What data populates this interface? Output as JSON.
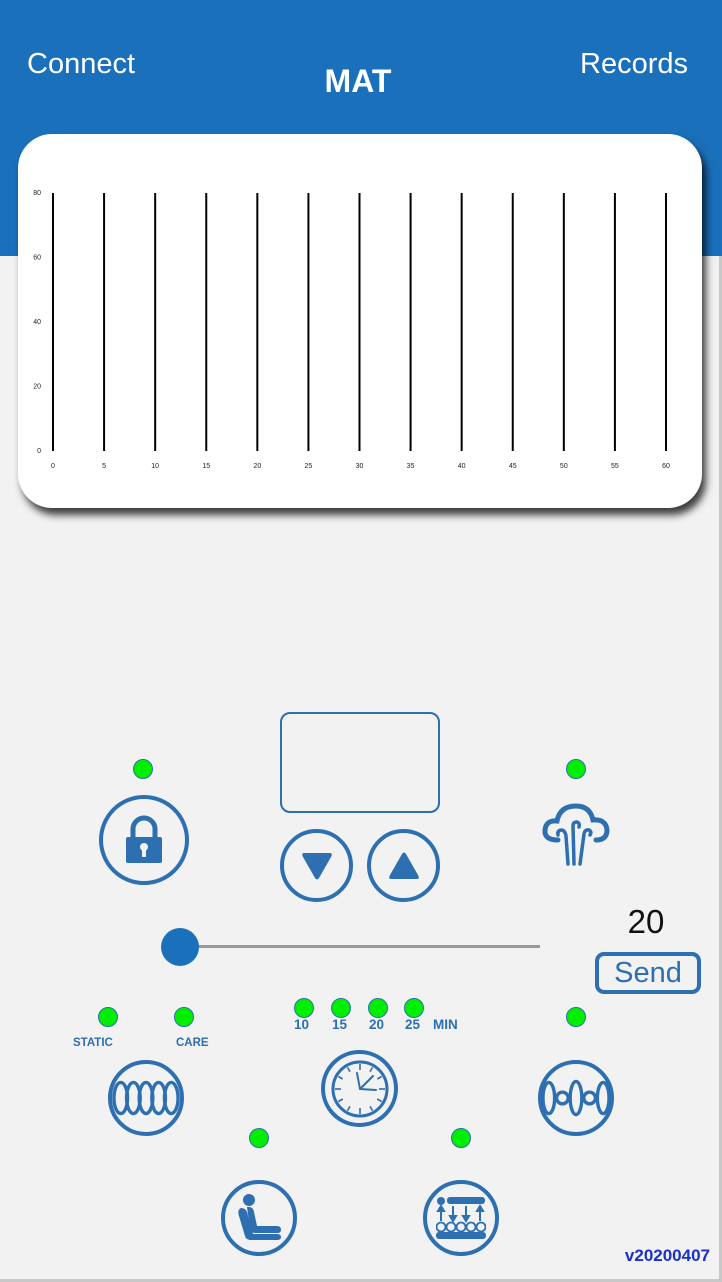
{
  "header": {
    "left_action": "Connect",
    "title": "MAT",
    "right_action": "Records",
    "background_color": "#1a70bb"
  },
  "chart_data": {
    "type": "bar",
    "title": "",
    "xlabel": "",
    "ylabel": "",
    "x": [
      0,
      5,
      10,
      15,
      20,
      25,
      30,
      35,
      40,
      45,
      50,
      55,
      60
    ],
    "values": [
      80,
      80,
      80,
      80,
      80,
      80,
      80,
      80,
      80,
      80,
      80,
      80,
      80
    ],
    "xlim": [
      0,
      60
    ],
    "ylim": [
      0,
      80
    ],
    "x_ticks": [
      "0",
      "5",
      "10",
      "15",
      "20",
      "25",
      "30",
      "35",
      "40",
      "45",
      "50",
      "55",
      "60"
    ],
    "y_ticks": [
      "0",
      "20",
      "40",
      "60",
      "80"
    ],
    "grid": false,
    "legend": "none",
    "bar_color": "#000000"
  },
  "controls": {
    "lock": {
      "icon": "lock-icon",
      "led_on": true
    },
    "display_value": "",
    "down_icon": "triangle-down-icon",
    "up_icon": "triangle-up-icon",
    "steam": {
      "icon": "steam-cloud-icon",
      "led_on": true
    },
    "slider": {
      "value": 20,
      "min": 20,
      "max": 100
    },
    "slider_value_text": "20",
    "send_label": "Send",
    "mode": {
      "labels": [
        "STATIC",
        "CARE"
      ],
      "icon": "coil-mattress-icon"
    },
    "timer": {
      "options": [
        "10",
        "15",
        "20",
        "25"
      ],
      "unit": "MIN",
      "icon": "clock-icon"
    },
    "wave": {
      "icon": "alternating-cells-icon",
      "led_on": true
    },
    "seat": {
      "icon": "seated-person-icon",
      "led_on": true
    },
    "pressure": {
      "icon": "pressure-cells-icon",
      "led_on": true
    }
  },
  "colors": {
    "accent": "#2d6fb0",
    "led_on": "#00ee00",
    "version_text": "#1a30c8"
  },
  "footer": {
    "version": "v20200407"
  }
}
